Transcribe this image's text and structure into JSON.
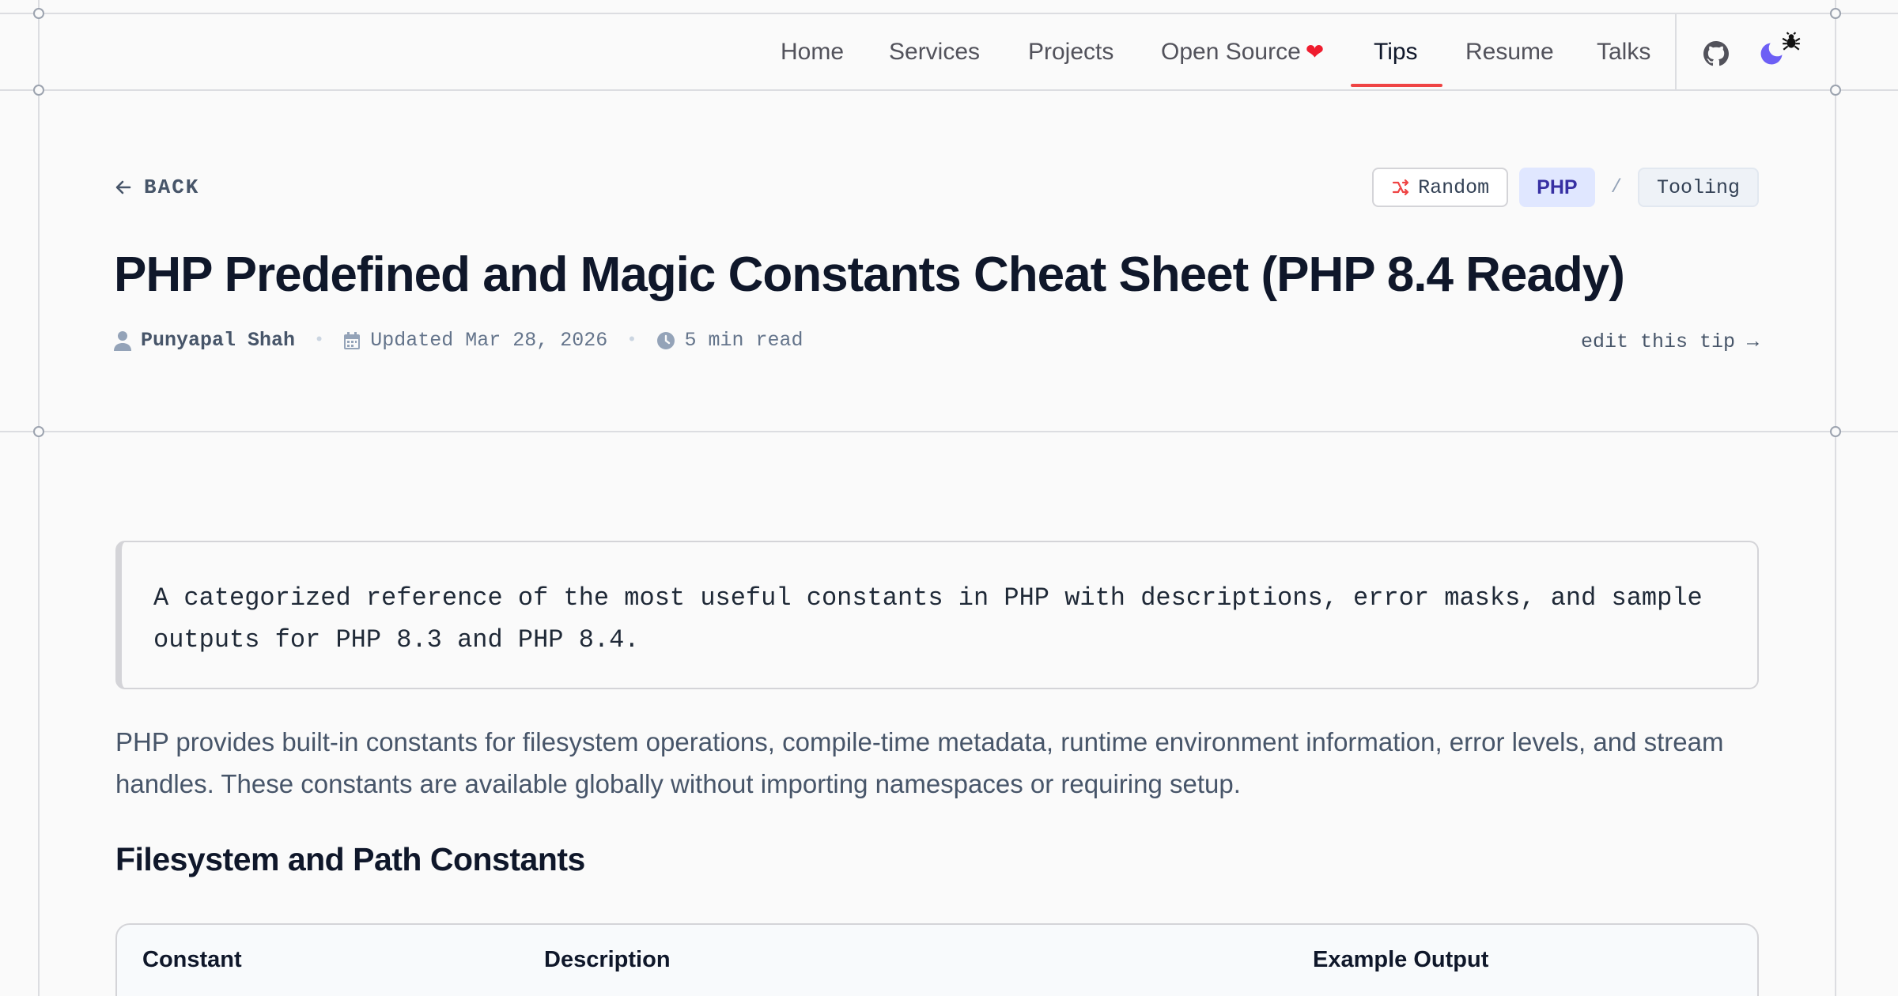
{
  "nav": {
    "items": [
      {
        "label": "Home"
      },
      {
        "label": "Services"
      },
      {
        "label": "Projects"
      },
      {
        "label": "Open Source"
      },
      {
        "label": "Tips"
      },
      {
        "label": "Resume"
      },
      {
        "label": "Talks"
      }
    ],
    "active": "Tips",
    "accent_color": "#ef4444",
    "icons": [
      "github-icon",
      "moon-icon",
      "bug-icon"
    ]
  },
  "header": {
    "back_label": "BACK",
    "random_label": "Random",
    "tags": [
      "PHP",
      "Tooling"
    ],
    "tag_separator": "/",
    "title": "PHP Predefined and Magic Constants Cheat Sheet (PHP 8.4 Ready)",
    "author": "Punyapal Shah",
    "updated": "Updated Mar 28, 2026",
    "read_time": "5 min read",
    "edit_link": "edit this tip →"
  },
  "content": {
    "callout": "A categorized reference of the most useful constants in PHP with descriptions, error masks, and sample outputs for PHP 8.3 and PHP 8.4.",
    "lead": "PHP provides built-in constants for filesystem operations, compile-time metadata, runtime environment information, error levels, and stream handles. These constants are available globally without importing namespaces or requiring setup.",
    "section_heading": "Filesystem and Path Constants",
    "table_headers": [
      "Constant",
      "Description",
      "Example Output"
    ]
  }
}
